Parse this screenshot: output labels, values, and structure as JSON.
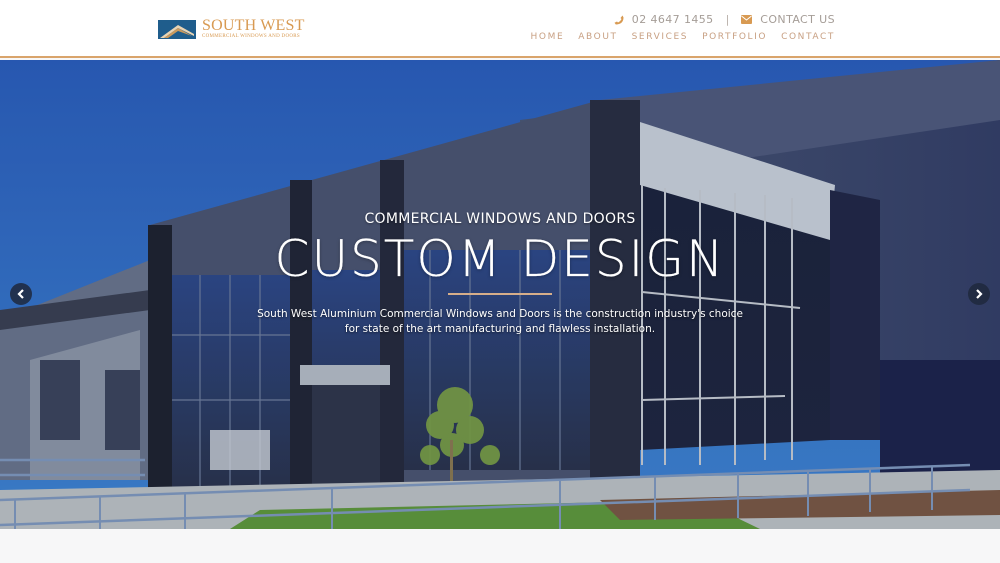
{
  "header": {
    "logo": {
      "title": "SOUTH WEST",
      "subtitle": "Commercial Windows and Doors"
    },
    "contact": {
      "phone_icon": "phone-icon",
      "phone": "02 4647 1455",
      "separator": "|",
      "email_icon": "envelope-icon",
      "contact_us": "CONTACT US"
    },
    "nav": [
      {
        "label": "HOME"
      },
      {
        "label": "ABOUT"
      },
      {
        "label": "SERVICES"
      },
      {
        "label": "PORTFOLIO"
      },
      {
        "label": "CONTACT"
      }
    ]
  },
  "hero": {
    "kicker": "COMMERCIAL WINDOWS AND DOORS",
    "headline": "CUSTOM DESIGN",
    "description": "South West Aluminium Commercial Windows and Doors is the construction industry's choice for state of the art manufacturing and flawless installation.",
    "prev_icon": "chevron-left-icon",
    "next_icon": "chevron-right-icon",
    "image_subject": "Commercial building with glass curtain wall facade"
  },
  "colors": {
    "accent": "#d89a52",
    "nav_text": "#c8a083",
    "header_border": "#d9a46b",
    "logo_blue": "#1f5d8c"
  }
}
